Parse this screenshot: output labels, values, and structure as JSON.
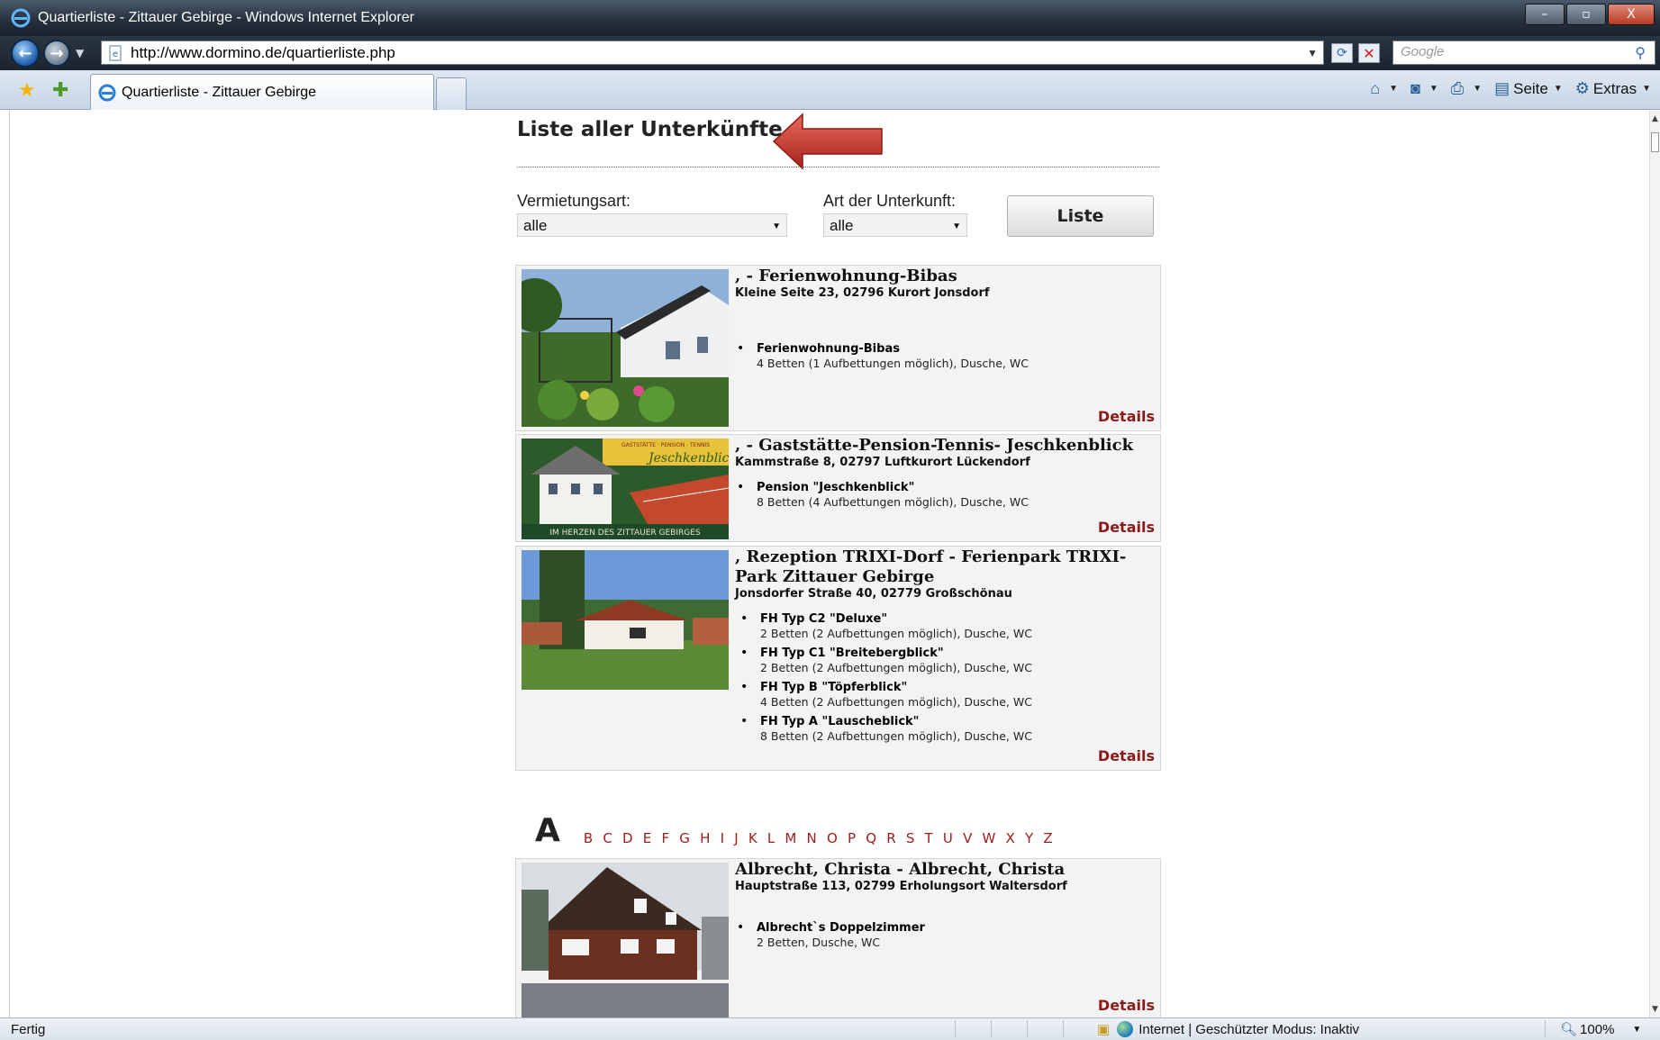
{
  "window": {
    "title": "Quartierliste - Zittauer Gebirge - Windows Internet Explorer",
    "controls": [
      "–",
      "▫",
      "X"
    ]
  },
  "addressbar": {
    "url": "http://www.dormino.de/quartierliste.php",
    "search_placeholder": "Google"
  },
  "tabs": [
    {
      "label": "Quartierliste - Zittauer Gebirge"
    }
  ],
  "commandbar": {
    "page_label": "Seite",
    "tools_label": "Extras"
  },
  "page": {
    "heading": "Liste aller Unterkünfte",
    "filters": {
      "rental_type_label": "Vermietungsart:",
      "rental_type_value": "alle",
      "accommodation_type_label": "Art der Unterkunft:",
      "accommodation_type_value": "alle",
      "list_button": "Liste"
    },
    "details_label": "Details",
    "featured": [
      {
        "name": ", - Ferienwohnung-Bibas",
        "address": "Kleine Seite 23, 02796 Kurort Jonsdorf",
        "units": [
          {
            "name": "Ferienwohnung-Bibas",
            "beds": "4 Betten (1 Aufbettungen möglich), Dusche, WC"
          }
        ]
      },
      {
        "name": ", - Gaststätte-Pension-Tennis- Jeschkenblick",
        "address": "Kammstraße 8, 02797 Luftkurort Lückendorf",
        "image_caption": "IM HERZEN DES ZITTAUER GEBIRGES",
        "units": [
          {
            "name": "Pension \"Jeschkenblick\"",
            "beds": "8 Betten (4 Aufbettungen möglich), Dusche, WC"
          }
        ]
      },
      {
        "name": ", Rezeption TRIXI-Dorf - Ferienpark TRIXI-Park Zittauer Gebirge",
        "address": "Jonsdorfer Straße 40, 02779 Großschönau",
        "units": [
          {
            "name": "FH Typ C2 \"Deluxe\"",
            "beds": "2 Betten (2 Aufbettungen möglich), Dusche, WC"
          },
          {
            "name": "FH Typ C1 \"Breitebergblick\"",
            "beds": "2 Betten (2 Aufbettungen möglich), Dusche, WC"
          },
          {
            "name": "FH Typ B \"Töpferblick\"",
            "beds": "4 Betten (2 Aufbettungen möglich), Dusche, WC"
          },
          {
            "name": "FH Typ A \"Lauscheblick\"",
            "beds": "8 Betten (2 Aufbettungen möglich), Dusche, WC"
          }
        ]
      }
    ],
    "alphabet": {
      "active": "A",
      "letters": [
        "B",
        "C",
        "D",
        "E",
        "F",
        "G",
        "H",
        "I",
        "J",
        "K",
        "L",
        "M",
        "N",
        "O",
        "P",
        "Q",
        "R",
        "S",
        "T",
        "U",
        "V",
        "W",
        "X",
        "Y",
        "Z"
      ]
    },
    "listing": [
      {
        "name": "Albrecht, Christa - Albrecht, Christa",
        "address": "Hauptstraße 113, 02799 Erholungsort Waltersdorf",
        "units": [
          {
            "name": "Albrecht`s Doppelzimmer",
            "beds": "2 Betten, Dusche, WC"
          }
        ]
      }
    ]
  },
  "statusbar": {
    "status": "Fertig",
    "zone": "Internet | Geschützter Modus: Inaktiv",
    "zoom": "100%"
  }
}
